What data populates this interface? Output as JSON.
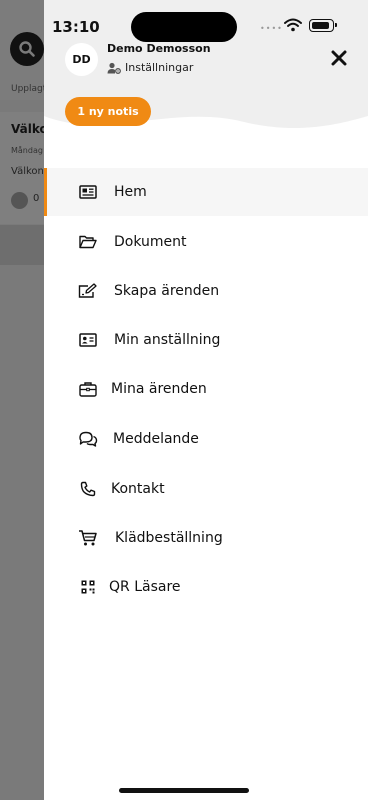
{
  "status_bar": {
    "time": "13:10"
  },
  "background": {
    "posted_label": "Upplagt",
    "card_title": "Välko",
    "card_date": "Måndag",
    "card_text": "Välkon",
    "like_count": "0"
  },
  "profile": {
    "initials": "DD",
    "name": "Demo Demosson",
    "settings_label": "Inställningar"
  },
  "notification_badge": "1 ny notis",
  "menu": {
    "items": [
      {
        "label": "Hem",
        "icon": "news-icon"
      },
      {
        "label": "Dokument",
        "icon": "folder-icon"
      },
      {
        "label": "Skapa ärenden",
        "icon": "edit-icon"
      },
      {
        "label": "Min anställning",
        "icon": "id-card-icon"
      },
      {
        "label": "Mina ärenden",
        "icon": "briefcase-icon"
      },
      {
        "label": "Meddelande",
        "icon": "chat-icon"
      },
      {
        "label": "Kontakt",
        "icon": "phone-icon"
      },
      {
        "label": "Klädbeställning",
        "icon": "cart-icon"
      },
      {
        "label": "QR Läsare",
        "icon": "qr-icon"
      }
    ]
  },
  "colors": {
    "accent": "#f08a14",
    "drawer_top": "#efefef",
    "overlay": "#7a7a7a"
  }
}
